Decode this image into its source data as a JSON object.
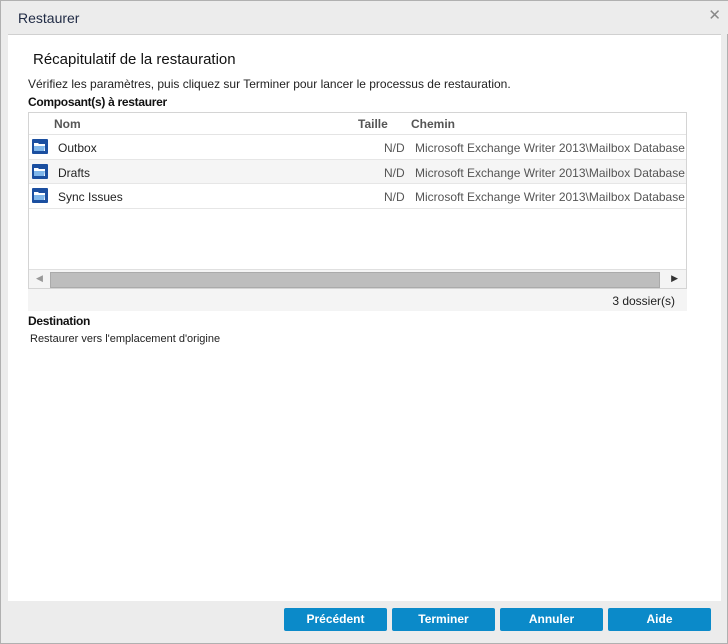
{
  "window": {
    "title": "Restaurer",
    "close_icon": "close-icon"
  },
  "heading": "Récapitulatif de la restauration",
  "description": "Vérifiez les paramètres, puis cliquez sur Terminer pour lancer le processus de restauration.",
  "components": {
    "label": "Composant(s) à restaurer",
    "columns": [
      "Nom",
      "Taille",
      "Chemin"
    ],
    "rows": [
      {
        "name": "Outbox",
        "size": "N/D",
        "path": "Microsoft Exchange Writer 2013\\Mailbox Database"
      },
      {
        "name": "Drafts",
        "size": "N/D",
        "path": "Microsoft Exchange Writer 2013\\Mailbox Database"
      },
      {
        "name": "Sync Issues",
        "size": "N/D",
        "path": "Microsoft Exchange Writer 2013\\Mailbox Database"
      }
    ],
    "footer": "3 dossier(s)"
  },
  "destination": {
    "label": "Destination",
    "value": "Restaurer vers l'emplacement d'origine"
  },
  "buttons": {
    "previous": "Précédent",
    "finish": "Terminer",
    "cancel": "Annuler",
    "help": "Aide"
  }
}
